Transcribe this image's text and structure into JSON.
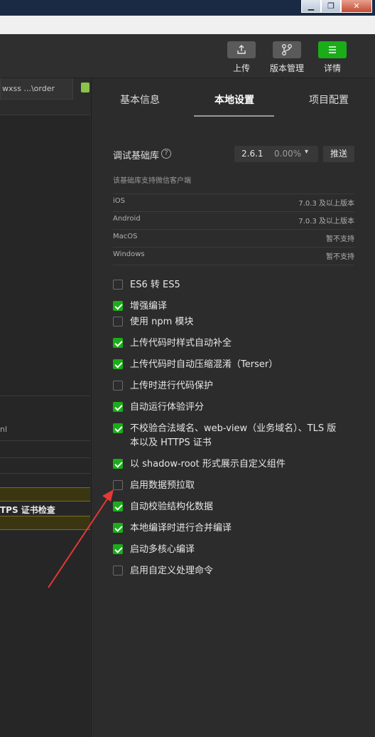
{
  "toolbar": {
    "upload_label": "上传",
    "version_label": "版本管理",
    "details_label": "详情"
  },
  "left": {
    "tab_label": "wxss ...\\order",
    "frag_ml": "nl",
    "frag_tls": "TPS 证书检查"
  },
  "tabs": {
    "basic": "基本信息",
    "local": "本地设置",
    "project": "项目配置"
  },
  "library": {
    "label": "调试基础库",
    "help": "?",
    "version": "2.6.1",
    "percent": "0.00%",
    "caret": "▾",
    "push": "推送"
  },
  "support": {
    "heading": "该基础库支持微信客户端",
    "rows": [
      {
        "platform": "iOS",
        "status": "7.0.3 及以上版本"
      },
      {
        "platform": "Android",
        "status": "7.0.3 及以上版本"
      },
      {
        "platform": "MacOS",
        "status": "暂不支持"
      },
      {
        "platform": "Windows",
        "status": "暂不支持"
      }
    ]
  },
  "options": [
    {
      "label": "ES6 转 ES5",
      "checked": false
    },
    {
      "label": "增强编译",
      "checked": true
    },
    {
      "label": "使用 npm 模块",
      "checked": false
    },
    {
      "label": "上传代码时样式自动补全",
      "checked": true
    },
    {
      "label": "上传代码时自动压缩混淆（Terser）",
      "checked": true
    },
    {
      "label": "上传时进行代码保护",
      "checked": false
    },
    {
      "label": "自动运行体验评分",
      "checked": true
    },
    {
      "label": "不校验合法域名、web-view（业务域名）、TLS 版本以及 HTTPS 证书",
      "checked": true
    },
    {
      "label": "以 shadow-root 形式展示自定义组件",
      "checked": true
    },
    {
      "label": "启用数据预拉取",
      "checked": false
    },
    {
      "label": "自动校验结构化数据",
      "checked": true
    },
    {
      "label": "本地编译时进行合并编译",
      "checked": true
    },
    {
      "label": "启动多核心编译",
      "checked": true
    },
    {
      "label": "启用自定义处理命令",
      "checked": false
    }
  ],
  "colors": {
    "accent_green": "#1aad19",
    "annotation_arrow": "#e53935"
  }
}
